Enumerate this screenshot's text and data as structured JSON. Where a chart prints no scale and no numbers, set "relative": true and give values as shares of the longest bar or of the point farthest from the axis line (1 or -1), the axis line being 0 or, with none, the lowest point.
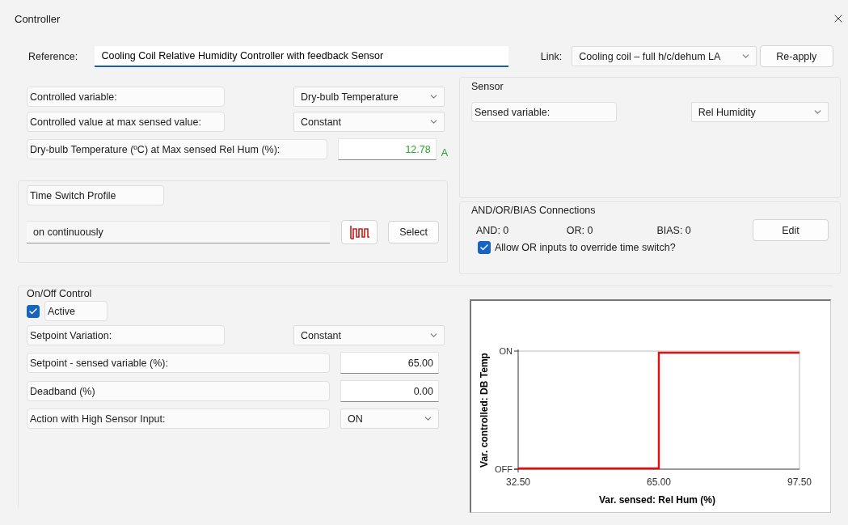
{
  "window": {
    "title": "Controller"
  },
  "reference": {
    "label": "Reference:",
    "value": "Cooling Coil Relative Humidity Controller with feedback Sensor"
  },
  "link": {
    "label": "Link:",
    "value": "Cooling coil – full h/c/dehum LA",
    "button": "Re-apply"
  },
  "controlled": [
    {
      "kind": "select",
      "label": "Controlled variable:",
      "value": "Dry-bulb Temperature"
    },
    {
      "kind": "select",
      "label": "Controlled value at max sensed value:",
      "value": "Constant"
    },
    {
      "kind": "number",
      "label": "Dry-bulb Temperature (ºC) at Max sensed Rel Hum (%):",
      "value": "12.78",
      "flag": "A"
    }
  ],
  "time_switch": {
    "title": "Time Switch Profile",
    "value": "on continuously",
    "button": "Select"
  },
  "sensor": {
    "title": "Sensor",
    "label": "Sensed variable:",
    "value": "Rel Humidity"
  },
  "connections": {
    "title": "AND/OR/BIAS Connections",
    "counts": [
      "AND: 0",
      "OR: 0",
      "BIAS: 0"
    ],
    "button": "Edit",
    "override": {
      "label": "Allow OR inputs to override time switch?",
      "checked": true
    }
  },
  "on_off": {
    "title": "On/Off Control",
    "active": {
      "label": "Active",
      "checked": true
    },
    "rows": [
      {
        "kind": "select",
        "label": "Setpoint Variation:",
        "value": "Constant"
      },
      {
        "kind": "number",
        "label": "Setpoint - sensed variable (%):",
        "value": "65.00"
      },
      {
        "kind": "number",
        "label": "Deadband (%)",
        "value": "0.00"
      },
      {
        "kind": "choice",
        "label": "Action with High Sensor Input:",
        "value": "ON"
      }
    ],
    "chart_data": {
      "type": "line",
      "xlabel": "Var. sensed: Rel Hum (%)",
      "ylabel": "Var. controlled: DB Temp",
      "x": [
        32.5,
        65,
        65,
        97.5
      ],
      "series": [
        {
          "color": "#e01010",
          "values": [
            0,
            0,
            1,
            1
          ]
        }
      ],
      "relative": true,
      "xlim": [
        32.5,
        97.5
      ],
      "xticks": [
        {
          "value": 32.5,
          "label": "32.50"
        },
        {
          "value": 65,
          "label": "65.00"
        },
        {
          "value": 97.5,
          "label": "97.50"
        }
      ],
      "y_categories": [
        "OFF",
        "ON"
      ]
    }
  }
}
